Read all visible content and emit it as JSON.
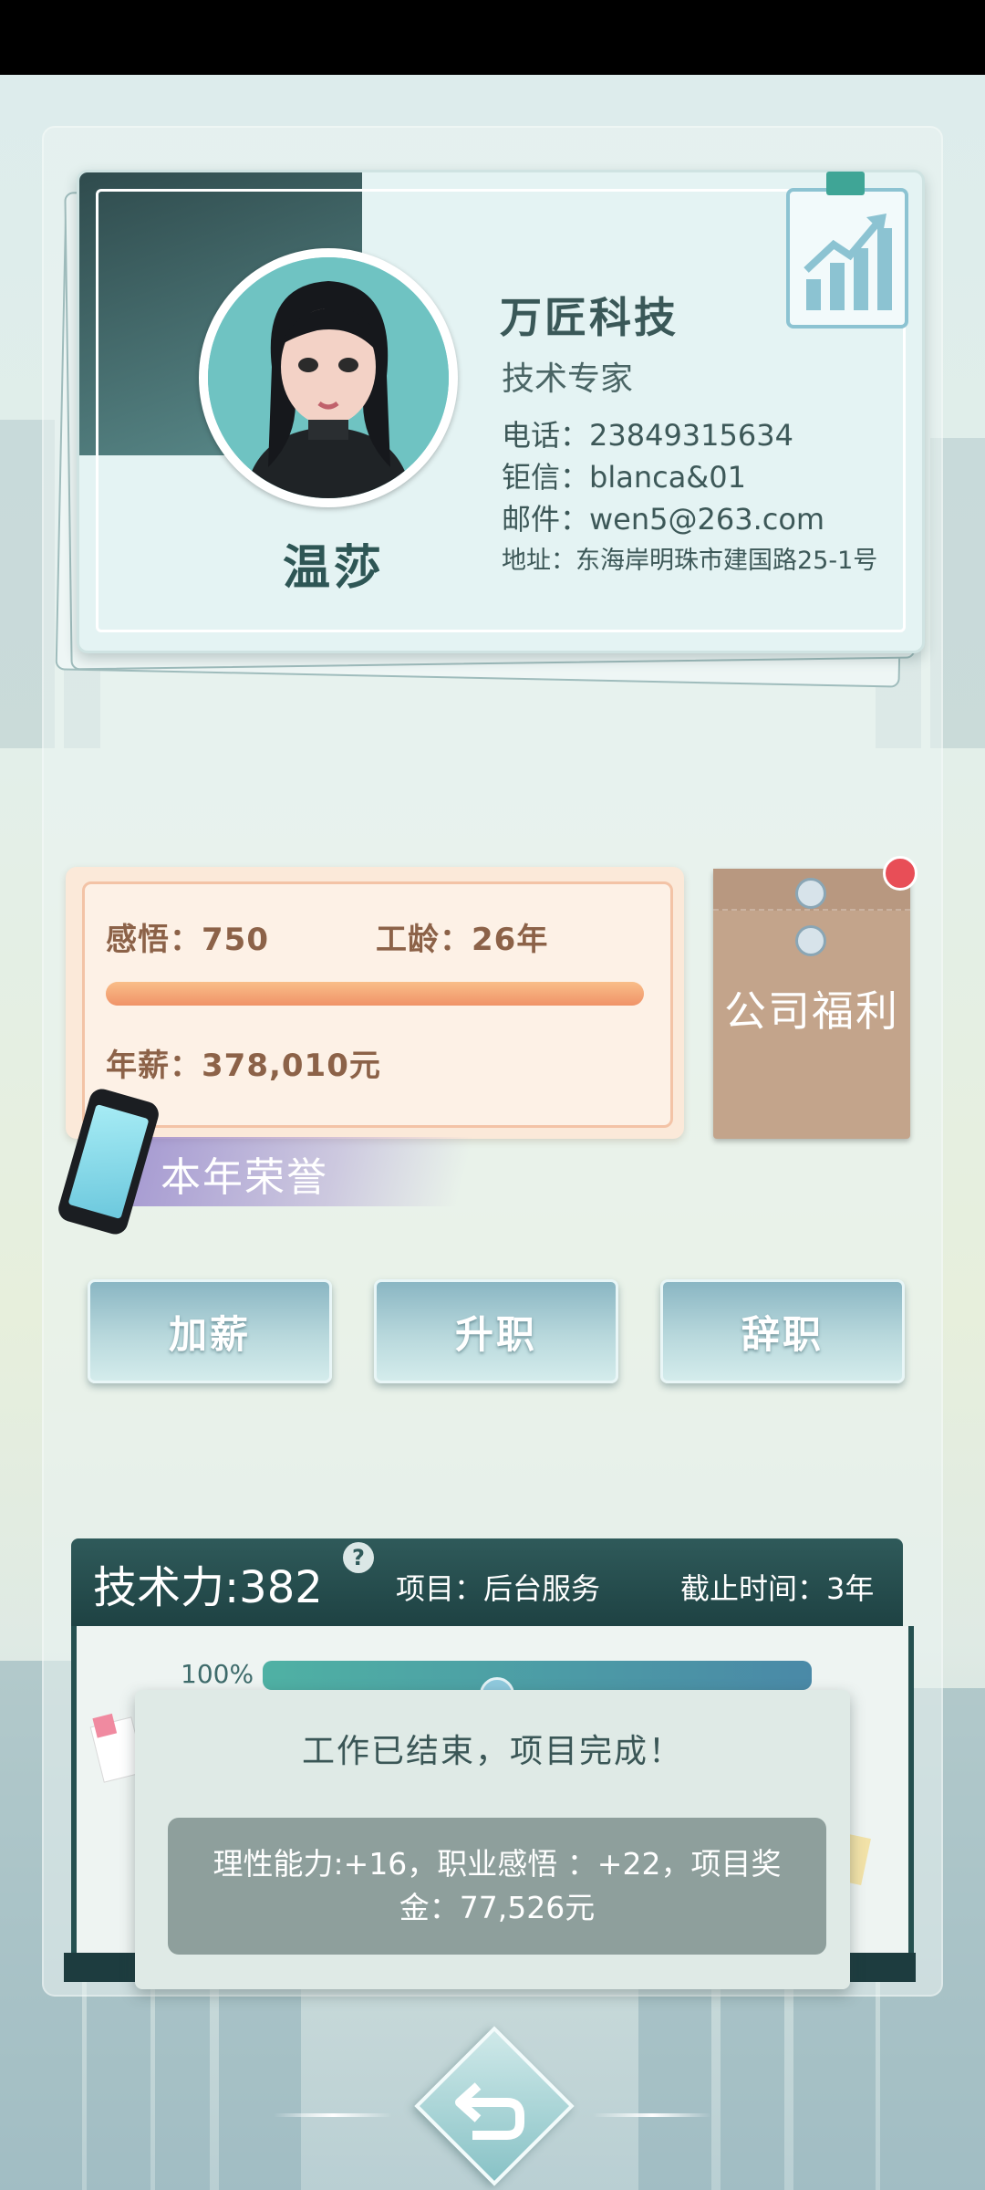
{
  "card": {
    "name": "温莎",
    "company": "万匠科技",
    "job_title": "技术专家",
    "phone": "电话：23849315634",
    "chat_id": "钜信：blanca&01",
    "email": "邮件：wen5@263.com",
    "address": "地址：东海岸明珠市建国路25-1号"
  },
  "stats": {
    "insight": "感悟：750",
    "seniority": "工龄：26年",
    "salary": "年薪：378,010元",
    "insight_bar_fraction": 1.0
  },
  "honor_label": "本年荣誉",
  "welfare_label": "公司福利",
  "actions": {
    "raise": "加薪",
    "promote": "升职",
    "resign": "辞职"
  },
  "project": {
    "tech_power": "技术力:382",
    "help_glyph": "?",
    "project_name": "项目：后台服务",
    "deadline": "截止时间：3年",
    "progress_text": "100%",
    "progress_fraction": 1.0
  },
  "popup": {
    "title": "工作已结束，项目完成！",
    "message": "理性能力:+16，职业感悟 ：+22，项目奖金：77,526元"
  },
  "colors": {
    "accent_teal": "#2f5a5a",
    "stat_brown": "#8c6248",
    "notification_red": "#e84e57"
  }
}
